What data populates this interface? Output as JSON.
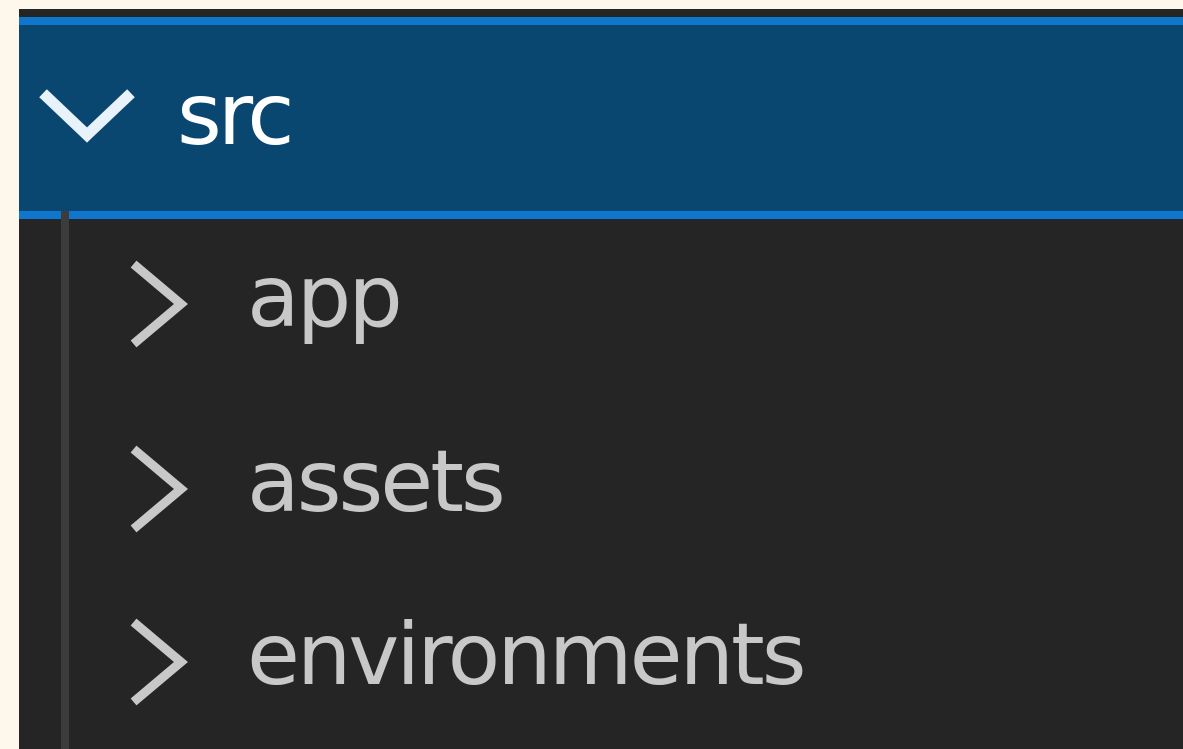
{
  "explorer": {
    "root_folder": {
      "label": "src",
      "state": "expanded",
      "icon": "chevron-down-icon"
    },
    "children": [
      {
        "label": "app",
        "state": "collapsed",
        "icon": "chevron-right-icon"
      },
      {
        "label": "assets",
        "state": "collapsed",
        "icon": "chevron-right-icon"
      },
      {
        "label": "environments",
        "state": "collapsed",
        "icon": "chevron-right-icon"
      }
    ]
  },
  "colors": {
    "background": "#252526",
    "selection": "#094771",
    "focus_border": "#0e76cc",
    "text": "#cccccc",
    "selected_text": "#ffffff"
  }
}
